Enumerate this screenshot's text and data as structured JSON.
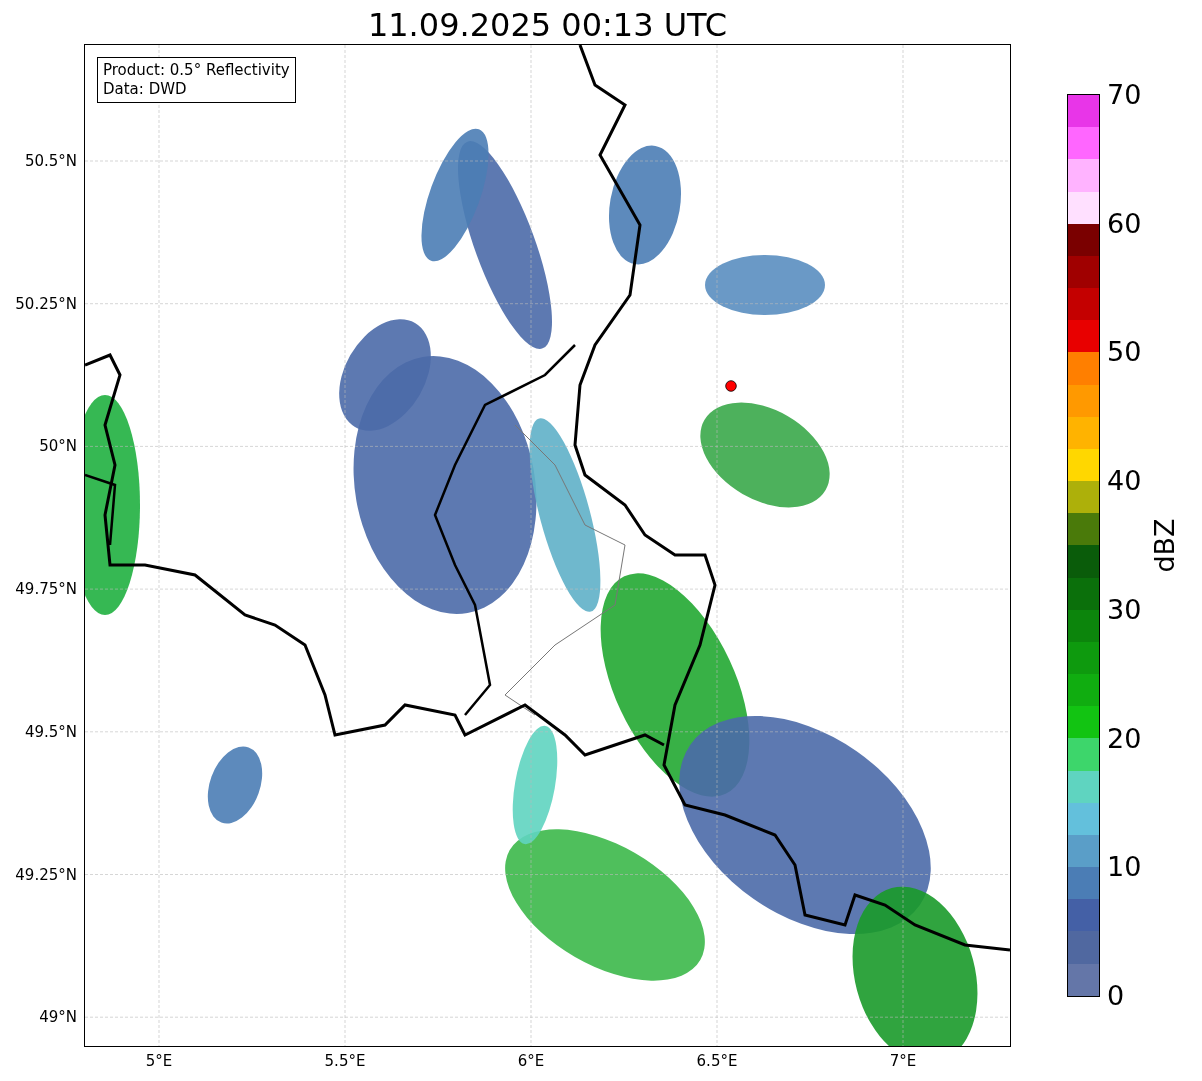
{
  "title": "11.09.2025 00:13 UTC",
  "map": {
    "legend": [
      "Product: 0.5° Reflectivity",
      "Data: DWD"
    ],
    "lat_labels": [
      "50.5°N",
      "50.25°N",
      "50°N",
      "49.75°N",
      "49.5°N",
      "49.25°N",
      "49°N"
    ],
    "lon_labels": [
      "5°E",
      "5.5°E",
      "6°E",
      "6.5°E",
      "7°E"
    ]
  },
  "colorbar": {
    "label": "dBZ",
    "ticks": [
      "70",
      "60",
      "50",
      "40",
      "30",
      "20",
      "10",
      "0"
    ],
    "bins": [
      {
        "color": "#e835e8"
      },
      {
        "color": "#ff66ff"
      },
      {
        "color": "#ffb3ff"
      },
      {
        "color": "#ffe0ff"
      },
      {
        "color": "#7a0000"
      },
      {
        "color": "#a00000"
      },
      {
        "color": "#c40000"
      },
      {
        "color": "#e80000"
      },
      {
        "color": "#ff7f00"
      },
      {
        "color": "#ff9900"
      },
      {
        "color": "#ffb300"
      },
      {
        "color": "#ffd700"
      },
      {
        "color": "#adb00a"
      },
      {
        "color": "#4a7a0a"
      },
      {
        "color": "#0a5c0a"
      },
      {
        "color": "#0b700b"
      },
      {
        "color": "#0c850c"
      },
      {
        "color": "#0e9a0e"
      },
      {
        "color": "#10ad10"
      },
      {
        "color": "#12c412"
      },
      {
        "color": "#3dd66b"
      },
      {
        "color": "#5fd4c0"
      },
      {
        "color": "#63c0dc"
      },
      {
        "color": "#5a9ec8"
      },
      {
        "color": "#4b7db5"
      },
      {
        "color": "#4460a6"
      },
      {
        "color": "#5068a0"
      },
      {
        "color": "#6476a8"
      }
    ]
  }
}
